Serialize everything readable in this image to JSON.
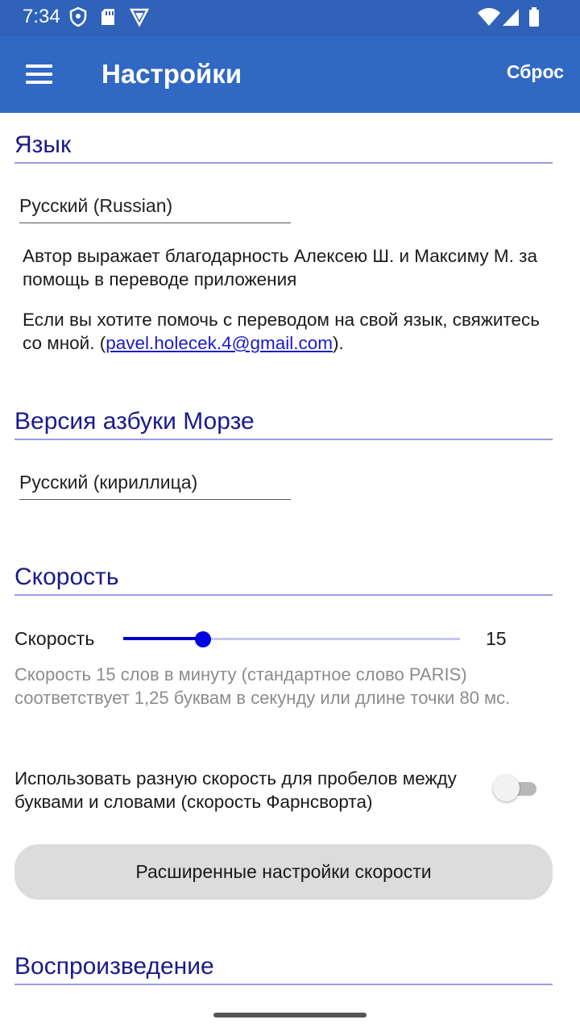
{
  "status_bar": {
    "time": "7:34",
    "icons_left": [
      "shield-icon",
      "sd-card-icon",
      "vpn-icon"
    ],
    "icons_right": [
      "wifi-icon",
      "signal-icon",
      "battery-icon"
    ]
  },
  "app_bar": {
    "title": "Настройки",
    "reset_label": "Сброс",
    "menu_icon": "hamburger-menu-icon",
    "color": "#3168c4"
  },
  "language": {
    "header": "Язык",
    "selected": "Русский (Russian)",
    "thanks": "Автор выражает благодарность Алексею Ш. и Максиму М. за помощь в переводе приложения",
    "help_prefix": "Если вы хотите помочь с переводом на свой язык, свяжитесь со мной. (",
    "help_email": "pavel.holecek.4@gmail.com",
    "help_suffix": ")."
  },
  "morse_version": {
    "header": "Версия азбуки Морзе",
    "selected": "Русский (кириллица)"
  },
  "speed": {
    "header": "Скорость",
    "label": "Скорость",
    "value": "15",
    "slider_fraction": 0.238,
    "description": "Скорость 15 слов в минуту (стандартное слово PARIS) соответствует 1,25 буквам в секунду или длине точки 80 мс.",
    "farnsworth_label": "Использовать разную скорость для пробелов между буквами и словами (скорость Фарнсворта)",
    "farnsworth_enabled": false,
    "advanced_button": "Расширенные настройки скорости"
  },
  "playback": {
    "header": "Воспроизведение"
  },
  "colors": {
    "section_header": "#1a1a8c",
    "slider_accent": "#0000e0",
    "link": "#1a1acc"
  }
}
